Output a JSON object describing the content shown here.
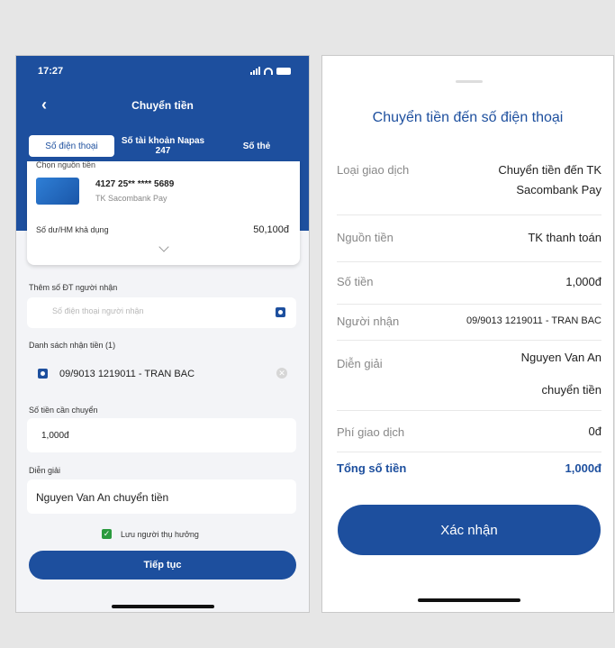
{
  "left": {
    "status": {
      "time": "17:27"
    },
    "header": {
      "title": "Chuyển tiền"
    },
    "tabs": [
      {
        "label": "Số điện thoại"
      },
      {
        "label": "Số tài khoản Napas 247"
      },
      {
        "label": "Số thẻ"
      }
    ],
    "source": {
      "label": "Chọn nguồn tiền",
      "card_number": "4127 25** **** 5689",
      "account_name": "TK Sacombank Pay",
      "balance_label": "Số dư/HM khả dụng",
      "balance_value": "50,100đ"
    },
    "recipient": {
      "label": "Thêm số ĐT người nhận",
      "placeholder": "Số điện thoại người nhận"
    },
    "list": {
      "label": "Danh sách nhận tiền (1)",
      "item": "09/9013 1219011 - TRAN BAC"
    },
    "amount": {
      "label": "Số tiền cần chuyển",
      "value": "1,000đ"
    },
    "description": {
      "label": "Diễn giải",
      "value": "Nguyen Van An chuyển tiền"
    },
    "save_label": "Lưu người thụ hưởng",
    "continue_label": "Tiếp tục"
  },
  "right": {
    "title": "Chuyển tiền đến số điện thoại",
    "rows": [
      {
        "key": "Loại giao dịch",
        "value": "Chuyển tiền đến TK Sacombank Pay"
      },
      {
        "key": "Nguồn tiền",
        "value": "TK thanh toán"
      },
      {
        "key": "Số tiền",
        "value": "1,000đ"
      },
      {
        "key": "Người nhận",
        "value": "09/9013 1219011 - TRAN BAC"
      },
      {
        "key": "Diễn giải",
        "value": "Nguyen Van An chuyển tiền"
      },
      {
        "key": "Phí giao dịch",
        "value": "0đ"
      },
      {
        "key": "Tổng số tiền",
        "value": "1,000đ"
      }
    ],
    "confirm_label": "Xác nhận"
  },
  "colors": {
    "primary": "#1d4f9e",
    "check": "#2a9a3e"
  }
}
